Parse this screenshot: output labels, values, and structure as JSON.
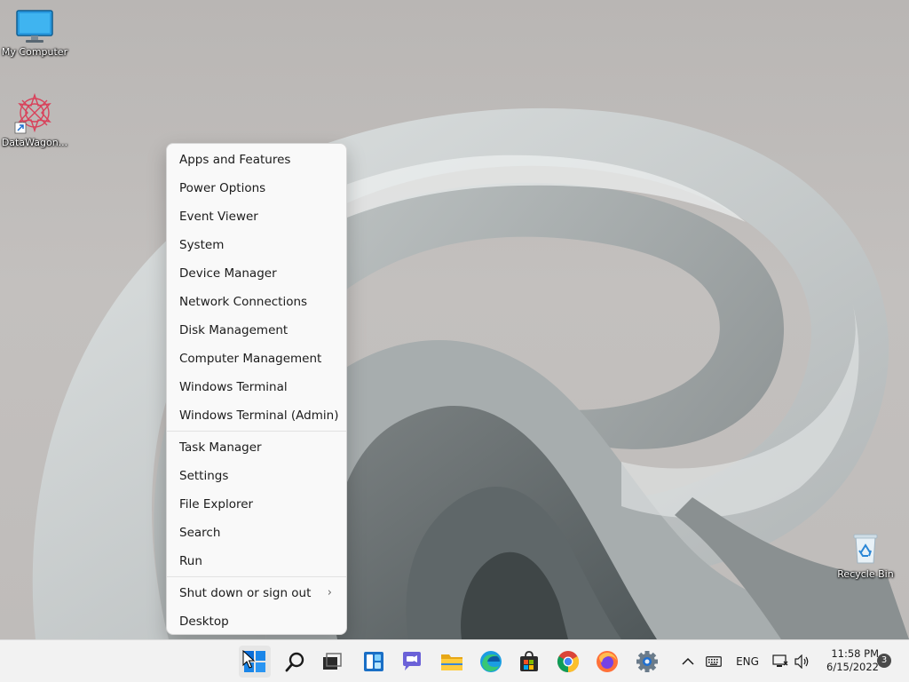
{
  "desktop": {
    "icons": [
      {
        "label": "My Computer",
        "icon": "monitor-icon"
      },
      {
        "label": "DataWagon...",
        "icon": "datawagon-icon"
      },
      {
        "label": "Recycle Bin",
        "icon": "recycle-bin-icon"
      }
    ]
  },
  "context_menu": {
    "group1": [
      {
        "label": "Apps and Features"
      },
      {
        "label": "Power Options"
      },
      {
        "label": "Event Viewer"
      },
      {
        "label": "System"
      },
      {
        "label": "Device Manager"
      },
      {
        "label": "Network Connections"
      },
      {
        "label": "Disk Management"
      },
      {
        "label": "Computer Management"
      },
      {
        "label": "Windows Terminal"
      },
      {
        "label": "Windows Terminal (Admin)"
      }
    ],
    "group2": [
      {
        "label": "Task Manager"
      },
      {
        "label": "Settings"
      },
      {
        "label": "File Explorer"
      },
      {
        "label": "Search"
      },
      {
        "label": "Run"
      }
    ],
    "group3": [
      {
        "label": "Shut down or sign out",
        "chevron": "›"
      },
      {
        "label": "Desktop"
      }
    ]
  },
  "taskbar": {
    "apps": [
      {
        "icon": "start-icon"
      },
      {
        "icon": "search-icon"
      },
      {
        "icon": "task-view-icon"
      },
      {
        "icon": "widgets-icon"
      },
      {
        "icon": "teams-chat-icon"
      },
      {
        "icon": "file-explorer-icon"
      },
      {
        "icon": "edge-icon"
      },
      {
        "icon": "store-icon"
      },
      {
        "icon": "chrome-icon"
      },
      {
        "icon": "firefox-icon"
      },
      {
        "icon": "settings-gear-icon"
      }
    ],
    "tray": {
      "language": "ENG",
      "time": "11:58 PM",
      "date": "6/15/2022",
      "notification_count": "3"
    }
  },
  "colors": {
    "menu_bg": "#f9f9f9",
    "taskbar_bg": "#f2f2f2",
    "windows_blue": "#0a6cd6",
    "text": "#1b1b1b"
  }
}
